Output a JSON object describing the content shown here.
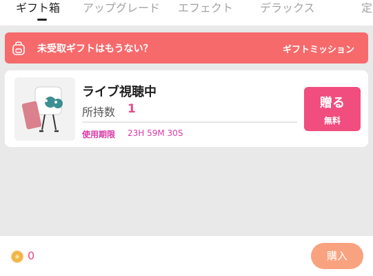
{
  "tabs": [
    {
      "label": "ギフト箱",
      "active": true
    },
    {
      "label": "アップグレード",
      "active": false
    },
    {
      "label": "エフェクト",
      "active": false
    },
    {
      "label": "デラックス",
      "active": false
    },
    {
      "label": "定",
      "active": false
    }
  ],
  "banner": {
    "text": "未受取ギフトはもうない？",
    "link": "ギフトミッション",
    "color": "#f66a6c"
  },
  "gift": {
    "name": "ライブ視聴中",
    "owned_label": "所持数",
    "owned_count": "1",
    "expiry_label": "使用期限",
    "expiry_time": "23H 59M 30S",
    "send_label": "贈る",
    "send_sub": "無料",
    "thumb_icon": "gift-character-image"
  },
  "footer": {
    "coin_icon": "coin-icon",
    "coin_count": "0",
    "buy_label": "購入"
  },
  "colors": {
    "accent_pink": "#f14d7f",
    "expiry_magenta": "#d93aa6",
    "buy_orange": "#f9a27f"
  }
}
